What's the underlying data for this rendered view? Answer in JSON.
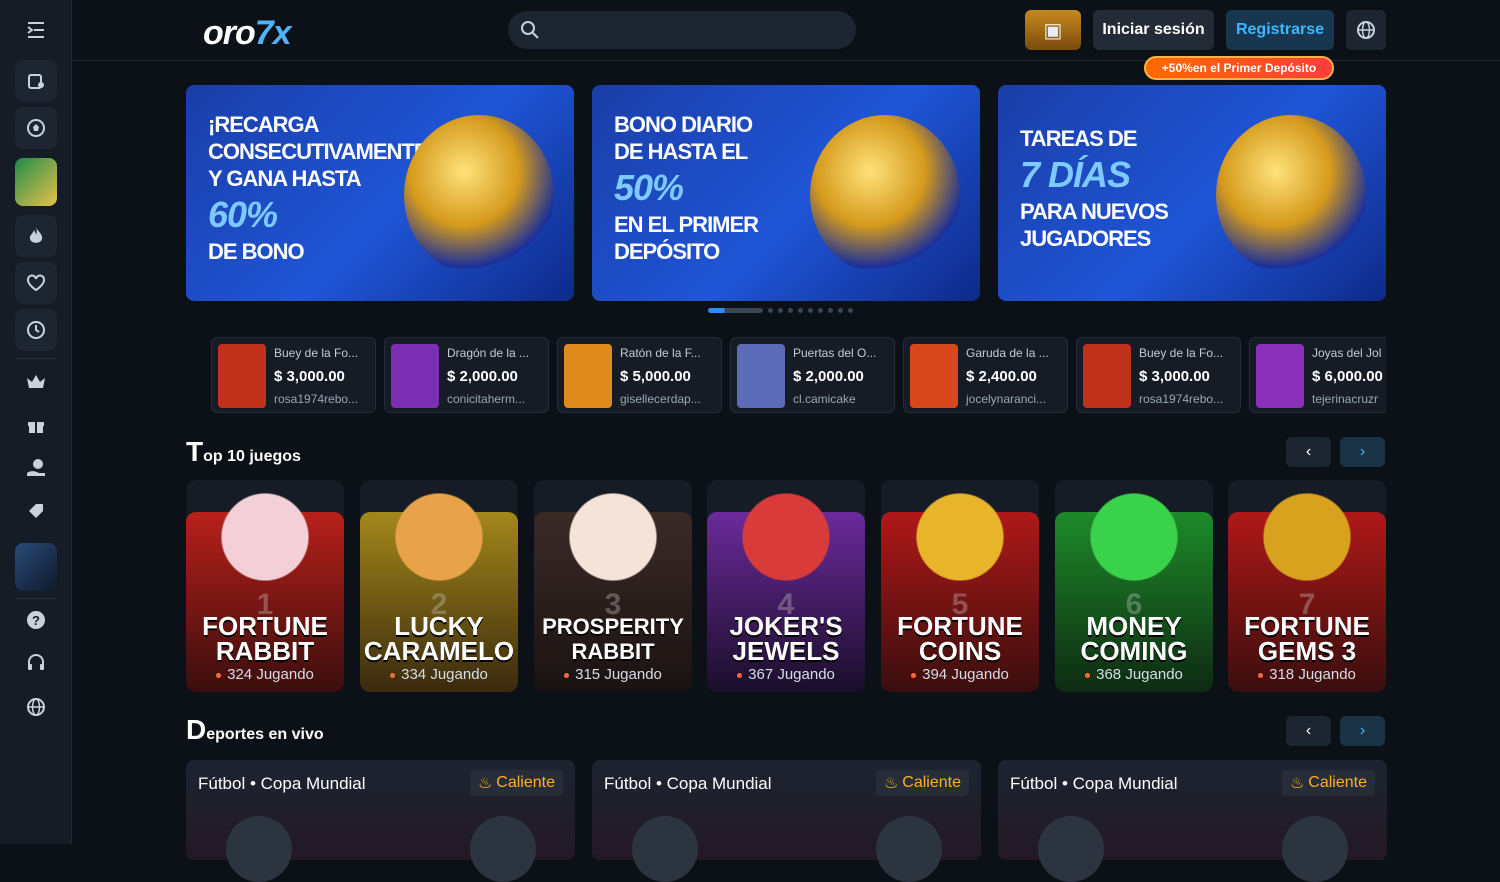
{
  "header": {
    "logo_prefix": "oro",
    "logo_suffix": "7x",
    "search_placeholder": "",
    "login_label": "Iniciar sesión",
    "register_label": "Registrarse",
    "promo_tag": "+50%en el Primer Depósito"
  },
  "sidebar": {
    "icons": [
      "menu-icon",
      "slot-machine-icon",
      "soccer-ball-icon",
      "promo-thumbnail",
      "fire-icon",
      "heart-icon",
      "clock-icon",
      "crown-icon",
      "gift-icon",
      "hand-coin-icon",
      "tag-icon",
      "app-thumbnail",
      "help-icon",
      "headset-icon",
      "globe-icon"
    ]
  },
  "banners": [
    {
      "text": "¡Recarga\nconsecutivamente\ny gana hasta",
      "big": "60%",
      "tail": "de bono"
    },
    {
      "text": "Bono diario\nde hasta el",
      "big": "50%",
      "tail": "en el primer\ndepósito"
    },
    {
      "text": "Tareas de",
      "big": "7 días",
      "tail": "para nuevos\njugadores"
    }
  ],
  "recent_wins": [
    {
      "game": "Buey de la Fo...",
      "amount": "$ 3,000.00",
      "user": "rosa1974rebo...",
      "color": "#c0311c"
    },
    {
      "game": "Dragón de la ...",
      "amount": "$ 2,000.00",
      "user": "conicitaherm...",
      "color": "#7a2fb3"
    },
    {
      "game": "Ratón de la F...",
      "amount": "$ 5,000.00",
      "user": "gisellecerdap...",
      "color": "#e08a1e"
    },
    {
      "game": "Puertas del O...",
      "amount": "$ 2,000.00",
      "user": "cl.camicake",
      "color": "#5b6bb8"
    },
    {
      "game": "Garuda de la ...",
      "amount": "$ 2,400.00",
      "user": "jocelynaranci...",
      "color": "#d9481c"
    },
    {
      "game": "Buey de la Fo...",
      "amount": "$ 3,000.00",
      "user": "rosa1974rebo...",
      "color": "#c0311c"
    },
    {
      "game": "Joyas del Jol",
      "amount": "$ 6,000.00",
      "user": "tejerinacruzr",
      "color": "#8a2fb8"
    }
  ],
  "top_games": {
    "title_first": "T",
    "title_rest": "op 10 juegos",
    "items": [
      {
        "rank": "1",
        "name": "Fortune\nRabbit",
        "players": "324 Jugando",
        "bg": "#b8201a",
        "char": "#f3d0d8"
      },
      {
        "rank": "2",
        "name": "Lucky\nCaramelo",
        "players": "334 Jugando",
        "bg": "#a3881a",
        "char": "#e8a24a"
      },
      {
        "rank": "3",
        "name": "Prosperity\nRabbit",
        "players": "315 Jugando",
        "bg": "#3a2a26",
        "char": "#f5e3d9"
      },
      {
        "rank": "4",
        "name": "Joker's\nJewels",
        "players": "367 Jugando",
        "bg": "#6a2a9a",
        "char": "#d93a3a"
      },
      {
        "rank": "5",
        "name": "Fortune\nCoins",
        "players": "394 Jugando",
        "bg": "#b01818",
        "char": "#e8b42a"
      },
      {
        "rank": "6",
        "name": "Money\nComing",
        "players": "368 Jugando",
        "bg": "#1e8a2a",
        "char": "#3ad24a"
      },
      {
        "rank": "7",
        "name": "Fortune\nGems 3",
        "players": "318 Jugando",
        "bg": "#b01818",
        "char": "#d9a21e"
      }
    ]
  },
  "live_sports": {
    "title_first": "D",
    "title_rest": "eportes en vivo",
    "items": [
      {
        "league": "Fútbol • Copa Mundial",
        "badge": "Caliente"
      },
      {
        "league": "Fútbol • Copa Mundial",
        "badge": "Caliente"
      },
      {
        "league": "Fútbol • Copa Mundial",
        "badge": "Caliente"
      }
    ]
  },
  "colors": {
    "accent": "#3fb6ff",
    "bg": "#0c1117",
    "panel": "#151c25",
    "hot": "#ffb020"
  }
}
